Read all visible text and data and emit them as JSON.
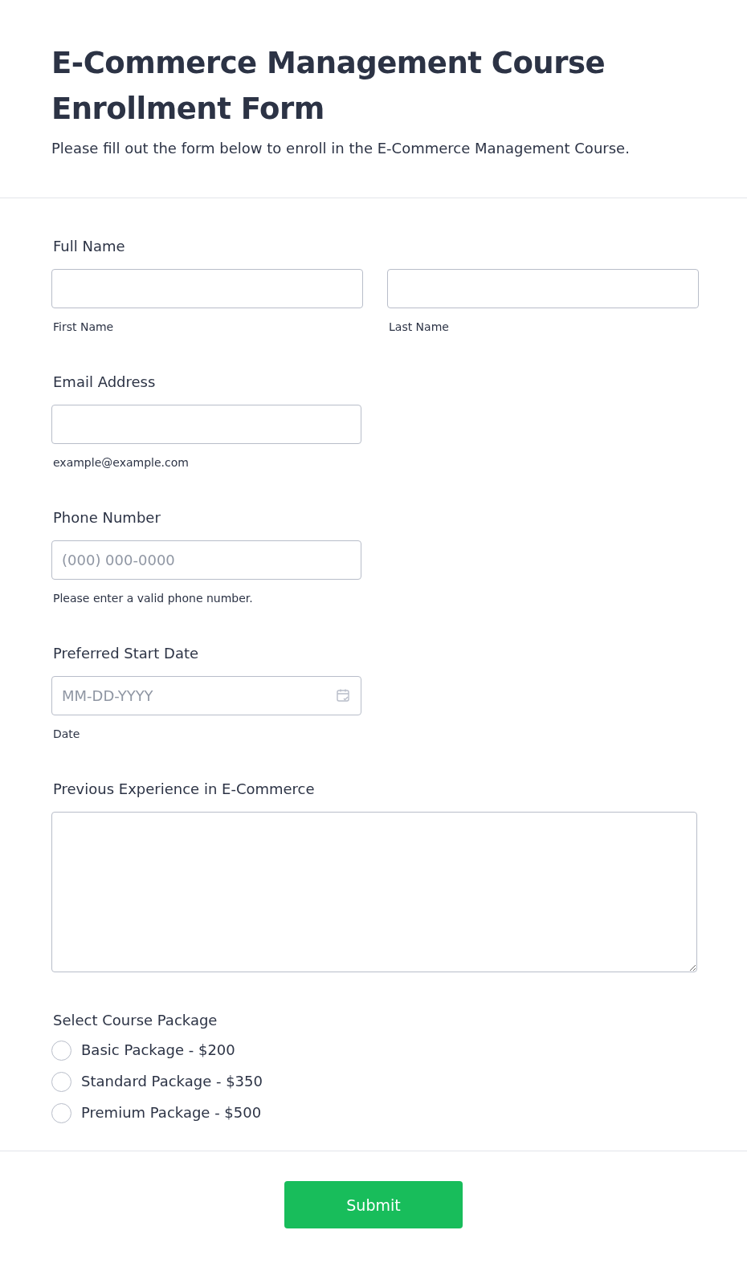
{
  "header": {
    "title": "E-Commerce Management Course Enrollment Form",
    "description": "Please fill out the form below to enroll in the E-Commerce Management Course."
  },
  "fields": [
    {
      "kind": "name",
      "label": "Full Name",
      "parts": [
        {
          "sublabel": "First Name"
        },
        {
          "sublabel": "Last Name"
        }
      ]
    },
    {
      "kind": "text",
      "label": "Email Address",
      "sublabel": "example@example.com"
    },
    {
      "kind": "text",
      "label": "Phone Number",
      "placeholder": "(000) 000-0000",
      "sublabel": "Please enter a valid phone number."
    },
    {
      "kind": "date",
      "label": "Preferred Start Date",
      "placeholder": "MM-DD-YYYY",
      "sublabel": "Date"
    },
    {
      "kind": "textarea",
      "label": "Previous Experience in E-Commerce"
    },
    {
      "kind": "radio",
      "label": "Select Course Package",
      "options": [
        {
          "label": "Basic Package - $200",
          "selected": false
        },
        {
          "label": "Standard Package - $350",
          "selected": false
        },
        {
          "label": "Premium Package - $500",
          "selected": false
        }
      ]
    }
  ],
  "submit": {
    "label": "Submit"
  }
}
